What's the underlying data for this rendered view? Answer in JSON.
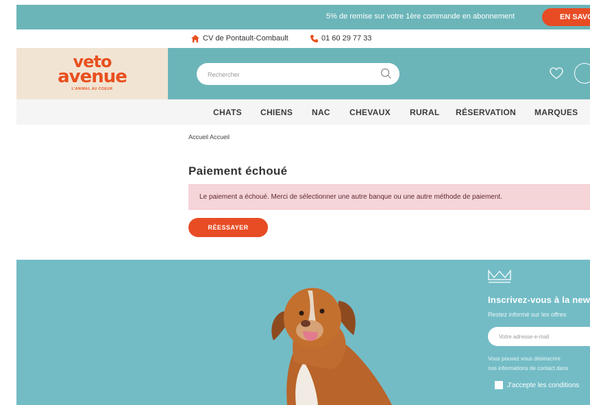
{
  "promo": {
    "text": "5% de remise sur votre 1ère commande en abonnement",
    "button_label": "EN SAVOIR PLUS"
  },
  "info": {
    "clinic": "CV de Pontault-Combault",
    "phone": "01 60 29 77 33"
  },
  "logo": {
    "line1": "veto",
    "line2": "avenue",
    "tagline": "L'ANIMAL AU COEUR"
  },
  "search": {
    "placeholder": "Rechercher"
  },
  "nav": {
    "items": [
      "CHATS",
      "CHIENS",
      "NAC",
      "CHEVAUX",
      "RURAL",
      "RÉSERVATION",
      "MARQUES"
    ]
  },
  "breadcrumb": "Accueil Accueil",
  "page": {
    "title": "Paiement échoué",
    "alert": "Le paiement a échoué. Merci de sélectionner une autre banque ou une autre méthode de paiement.",
    "retry_label": "RÉESSAYER"
  },
  "newsletter": {
    "title": "Inscrivez-vous à la newsletter",
    "subtitle": "Restez informé sur les offres",
    "email_placeholder": "Votre adresse e-mail",
    "note_line1": "Vous pouvez vous désinscrire",
    "note_line2": "nos informations de contact dans",
    "consent": "J'accepte les conditions"
  },
  "colors": {
    "teal": "#6bb5b9",
    "orange": "#e84c24",
    "beige": "#f2e4d3",
    "alert_bg": "#f6d5d9"
  }
}
